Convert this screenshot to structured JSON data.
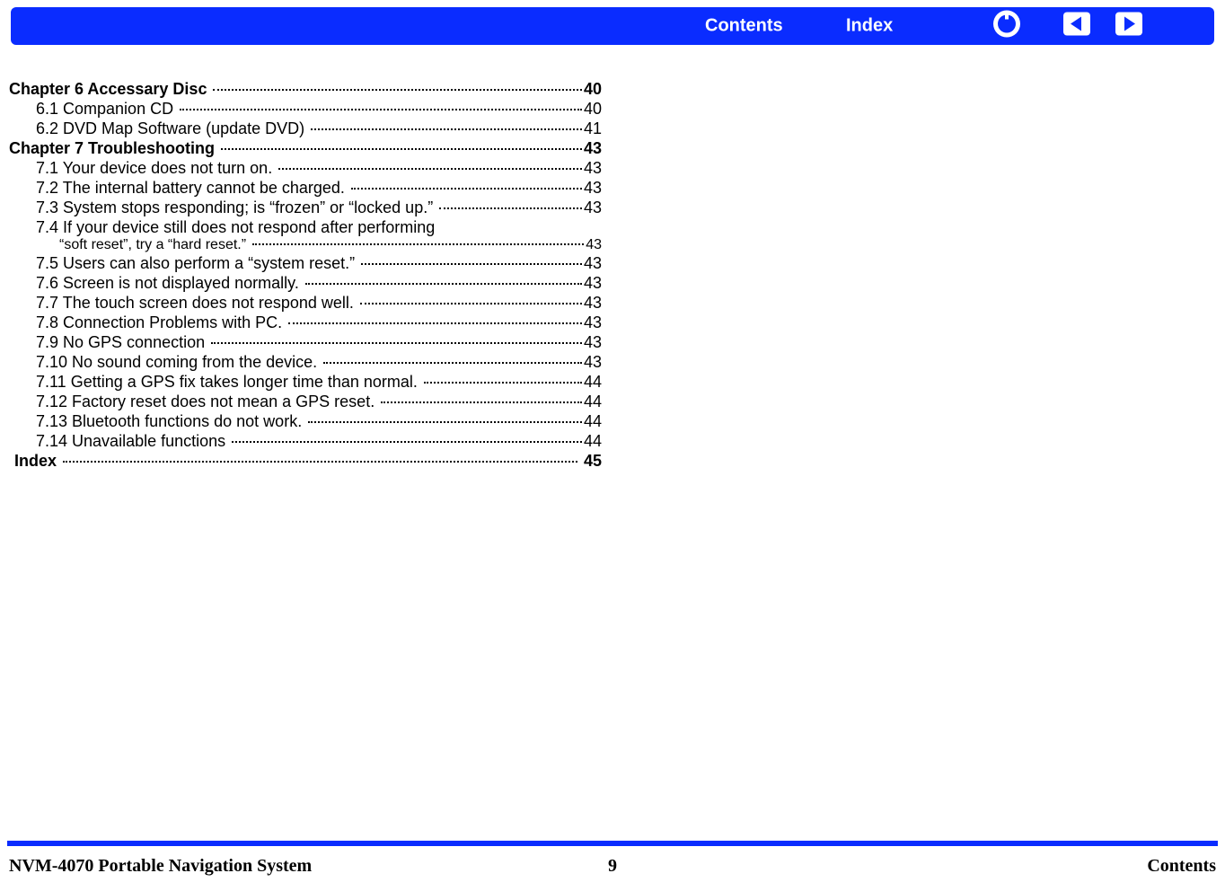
{
  "header": {
    "contents_label": "Contents",
    "index_label": "Index"
  },
  "toc": {
    "ch6": {
      "text": "Chapter 6 Accessary Disc ",
      "page": "40"
    },
    "s61": {
      "text": "6.1 Companion CD ",
      "page": "40"
    },
    "s62": {
      "text": "6.2 DVD Map Software (update DVD) ",
      "page": "41"
    },
    "ch7": {
      "text": "Chapter 7 Troubleshooting ",
      "page": "43"
    },
    "s71": {
      "text": "7.1 Your device does not turn on. ",
      "page": "43"
    },
    "s72": {
      "text": "7.2 The internal battery cannot be charged. ",
      "page": "43"
    },
    "s73": {
      "text": "7.3 System stops responding; is “frozen” or “locked up.” ",
      "page": "43"
    },
    "s74a": {
      "text": "7.4 If your device still does not respond after performing"
    },
    "s74b": {
      "text": "“soft reset”, try a “hard reset.” ",
      "page": "43"
    },
    "s75": {
      "text": "7.5 Users can also perform a “system reset.” ",
      "page": "43"
    },
    "s76": {
      "text": "7.6 Screen is not displayed normally. ",
      "page": "43"
    },
    "s77": {
      "text": "7.7 The touch screen does not respond well. ",
      "page": "43"
    },
    "s78": {
      "text": "7.8 Connection Problems with PC. ",
      "page": "43"
    },
    "s79": {
      "text": "7.9 No GPS connection ",
      "page": "43"
    },
    "s710": {
      "text": "7.10 No sound coming from the device. ",
      "page": "43"
    },
    "s711": {
      "text": "7.11 Getting a GPS fix takes longer time than normal. ",
      "page": "44"
    },
    "s712": {
      "text": "7.12 Factory reset does not mean a GPS reset. ",
      "page": "44"
    },
    "s713": {
      "text": "7.13 Bluetooth functions do not work. ",
      "page": "44"
    },
    "s714": {
      "text": "7.14 Unavailable functions ",
      "page": "44"
    },
    "index": {
      "text": "Index ",
      "page": " 45"
    }
  },
  "footer": {
    "left": "NVM-4070 Portable Navigation System",
    "center": "9",
    "right": "Contents"
  }
}
